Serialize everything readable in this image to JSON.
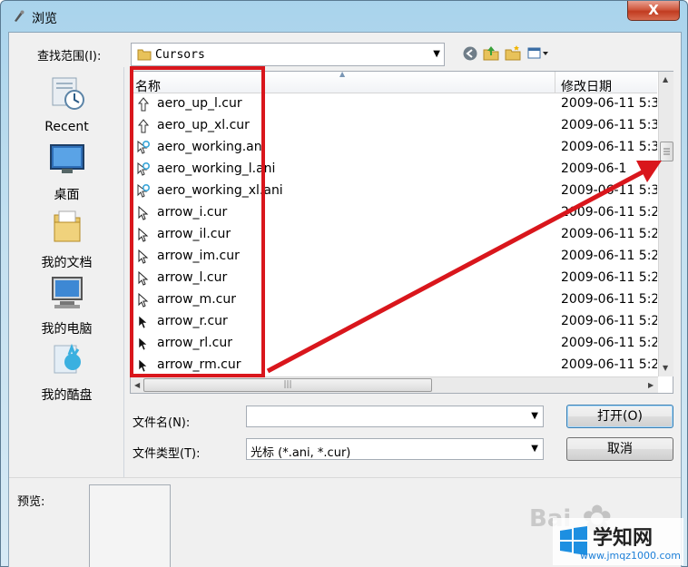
{
  "window": {
    "title": "浏览",
    "close_label": "X"
  },
  "toolbar": {
    "lookin_label": "查找范围(I):",
    "path": "Cursors",
    "icons": [
      "back-icon",
      "up-folder-icon",
      "new-folder-icon",
      "view-menu-icon"
    ]
  },
  "places": [
    {
      "label": "Recent",
      "icon": "recent-icon"
    },
    {
      "label": "桌面",
      "icon": "desktop-icon"
    },
    {
      "label": "我的文档",
      "icon": "documents-icon"
    },
    {
      "label": "我的电脑",
      "icon": "computer-icon"
    },
    {
      "label": "我的酷盘",
      "icon": "kupan-icon"
    }
  ],
  "filelist": {
    "col_name": "名称",
    "col_date": "修改日期",
    "rows": [
      {
        "name": "aero_up_l.cur",
        "date": "2009-06-11 5:3",
        "icon": "uparrow"
      },
      {
        "name": "aero_up_xl.cur",
        "date": "2009-06-11 5:3",
        "icon": "uparrow"
      },
      {
        "name": "aero_working.ani",
        "date": "2009-06-11 5:3",
        "icon": "working"
      },
      {
        "name": "aero_working_l.ani",
        "date": "2009-06-1",
        "icon": "working"
      },
      {
        "name": "aero_working_xl.ani",
        "date": "2009-06-11 5:3",
        "icon": "working"
      },
      {
        "name": "arrow_i.cur",
        "date": "2009-06-11 5:2",
        "icon": "arrow"
      },
      {
        "name": "arrow_il.cur",
        "date": "2009-06-11 5:2",
        "icon": "arrow"
      },
      {
        "name": "arrow_im.cur",
        "date": "2009-06-11 5:2",
        "icon": "arrow"
      },
      {
        "name": "arrow_l.cur",
        "date": "2009-06-11 5:2",
        "icon": "arrow"
      },
      {
        "name": "arrow_m.cur",
        "date": "2009-06-11 5:2",
        "icon": "arrow"
      },
      {
        "name": "arrow_r.cur",
        "date": "2009-06-11 5:2",
        "icon": "arrow-black"
      },
      {
        "name": "arrow_rl.cur",
        "date": "2009-06-11 5:2",
        "icon": "arrow-black"
      },
      {
        "name": "arrow_rm.cur",
        "date": "2009-06-11 5:2",
        "icon": "arrow-black"
      }
    ]
  },
  "form": {
    "filename_label": "文件名(N):",
    "filename_value": "",
    "filetype_label": "文件类型(T):",
    "filetype_value": "光标 (*.ani, *.cur)",
    "open_label": "打开(O)",
    "cancel_label": "取消"
  },
  "preview": {
    "label": "预览:"
  },
  "watermark": {
    "brand": "学知网",
    "url": "www.jmqz1000.com",
    "baidu": "Bai"
  },
  "colors": {
    "annotation": "#d9161c",
    "titlebar": "#a9d3ec",
    "close_button": "#c13b20"
  }
}
